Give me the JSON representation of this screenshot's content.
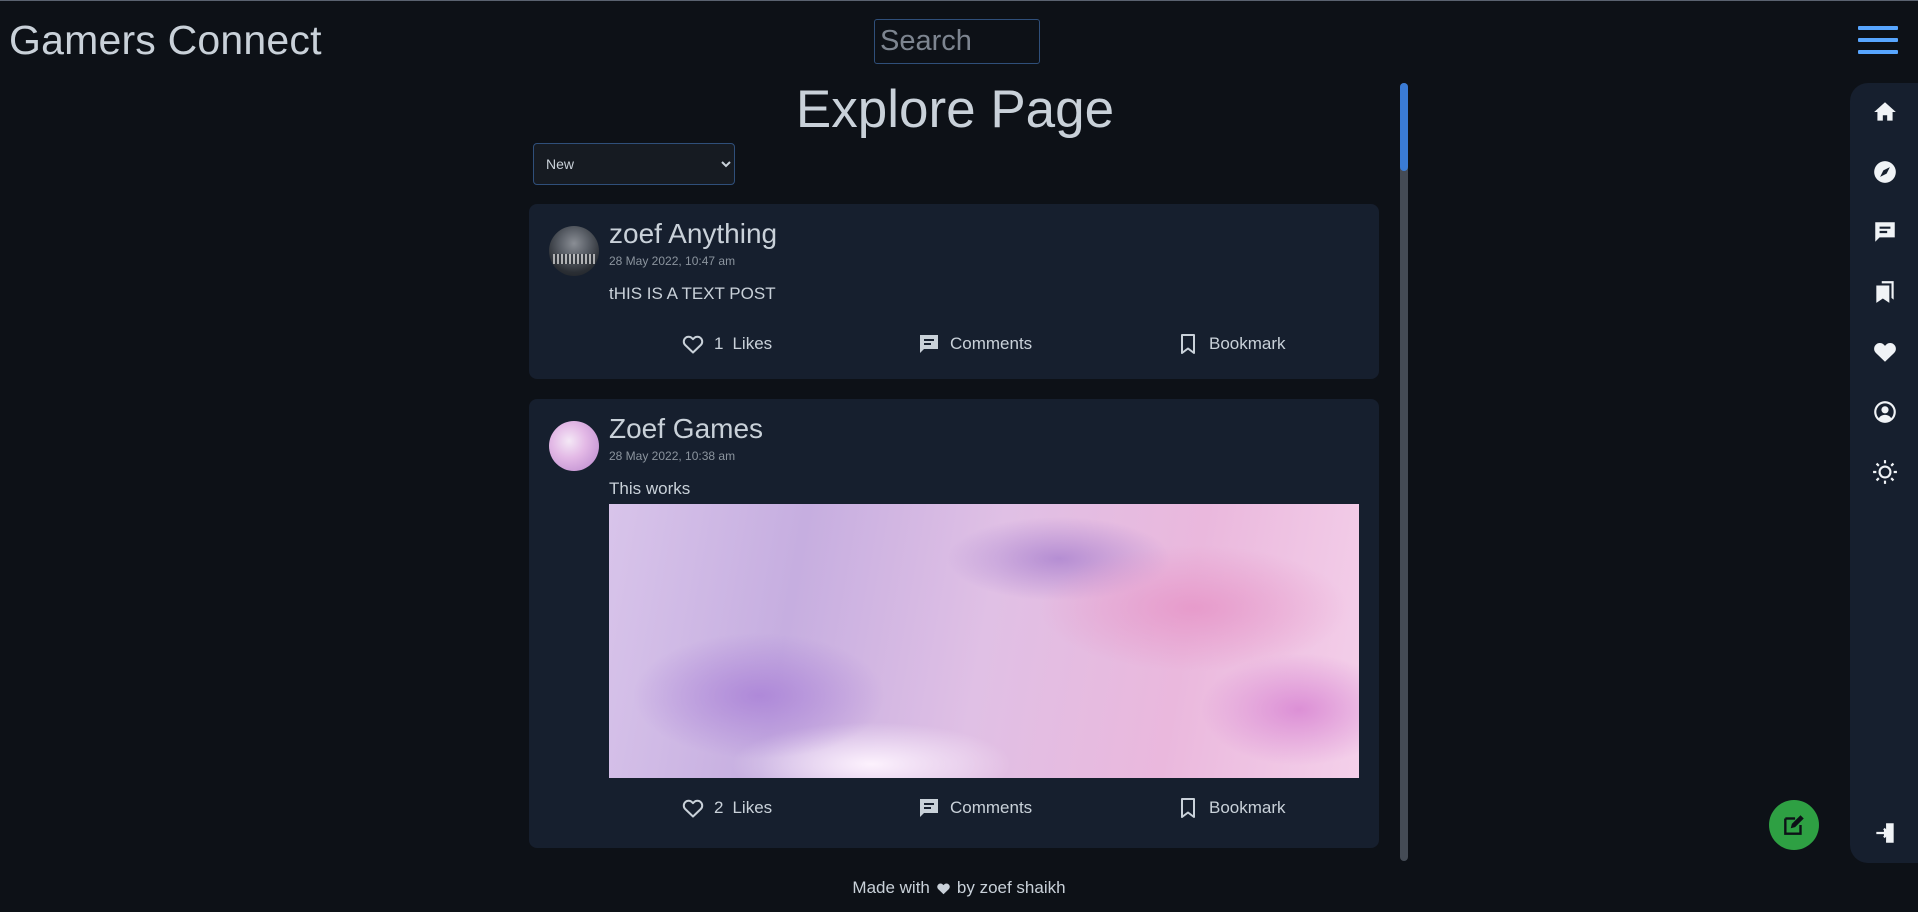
{
  "header": {
    "brand": "Gamers Connect",
    "search_placeholder": "Search"
  },
  "feed": {
    "title": "Explore Page",
    "sort_selected": "New"
  },
  "posts": [
    {
      "username": "zoef Anything",
      "timestamp": "28 May 2022, 10:47 am",
      "body": "tHIS IS A TEXT POST",
      "likes_count": "1",
      "likes_label": "Likes",
      "comments_label": "Comments",
      "bookmark_label": "Bookmark"
    },
    {
      "username": "Zoef Games",
      "timestamp": "28 May 2022, 10:38 am",
      "body": "This works",
      "likes_count": "2",
      "likes_label": "Likes",
      "comments_label": "Comments",
      "bookmark_label": "Bookmark"
    }
  ],
  "footer": {
    "before": "Made with",
    "after": "by zoef shaikh"
  },
  "sidebar": {
    "icons": [
      "home-icon",
      "explore-icon",
      "chat-icon",
      "bookmarks-icon",
      "favorites-icon",
      "profile-icon",
      "theme-toggle-icon",
      "logout-icon"
    ]
  },
  "colors": {
    "background": "#0d1117",
    "card": "#161f2e",
    "accent": "#58a6ff",
    "fab": "#2ea043",
    "text": "#c9d1d9"
  }
}
